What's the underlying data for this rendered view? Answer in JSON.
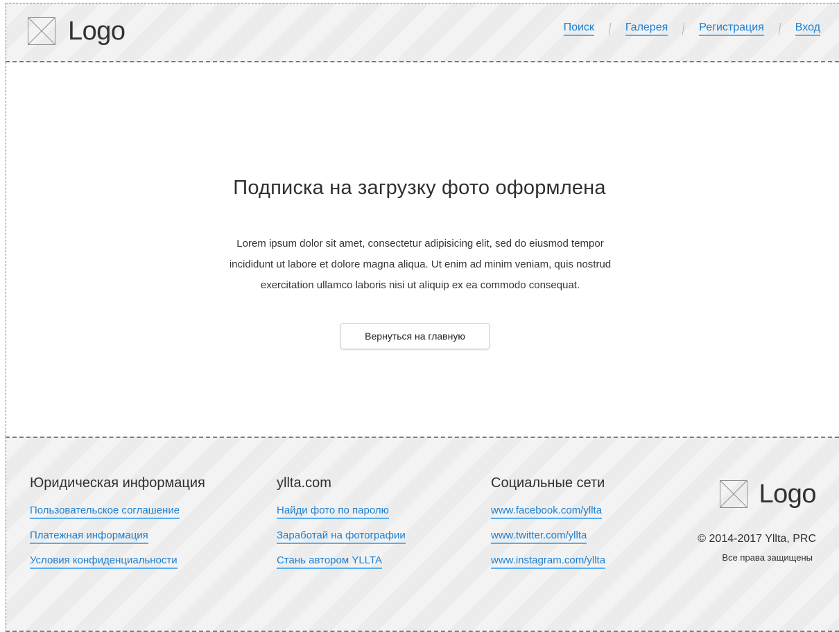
{
  "header": {
    "logo": {
      "text": "Logo",
      "icon": "image-placeholder-icon"
    },
    "nav": [
      {
        "label": "Поиск"
      },
      {
        "label": "Галерея"
      },
      {
        "label": "Регистрация"
      },
      {
        "label": "Вход"
      }
    ]
  },
  "main": {
    "title": "Подписка на загрузку фото оформлена",
    "text": "Lorem ipsum dolor sit amet, consectetur adipisicing elit, sed do eiusmod tempor incididunt ut labore et dolore magna aliqua. Ut enim ad minim veniam, quis nostrud exercitation ullamco laboris nisi ut aliquip ex ea commodo consequat.",
    "button_label": "Вернуться на главную"
  },
  "footer": {
    "columns": [
      {
        "title": "Юридическая информация",
        "links": [
          "Пользовательское соглашение",
          "Платежная информация",
          "Условия конфиденциальности"
        ]
      },
      {
        "title": "yllta.com",
        "links": [
          "Найди фото по паролю",
          "Заработай на фотографии",
          "Стань автором YLLTA"
        ]
      },
      {
        "title": "Социальные сети",
        "links": [
          "www.facebook.com/yllta",
          "www.twitter.com/yllta",
          "www.instagram.com/yllta"
        ]
      }
    ],
    "brand": {
      "logo_text": "Logo",
      "icon": "image-placeholder-icon",
      "copyright": "© 2014-2017 Yllta, PRC",
      "rights": "Все права защищены"
    }
  },
  "colors": {
    "link": "#1b7fd1",
    "underline": "#56aef0",
    "border": "#7b7b7b",
    "text": "#2f2f2f"
  }
}
